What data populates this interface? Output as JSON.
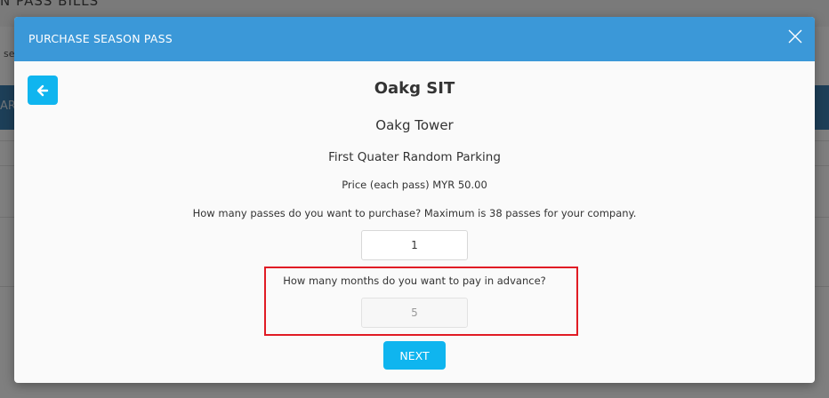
{
  "background": {
    "nav_text": "N PASS   BILLS",
    "search_text": "se",
    "band_text": "AR"
  },
  "modal": {
    "title": "PURCHASE SEASON PASS",
    "close_icon": "close-icon",
    "back_icon": "arrow-left-icon",
    "company_name": "Oakg SIT",
    "building": "Oakg Tower",
    "plan": "First Quater Random Parking",
    "price_text": "Price (each pass) MYR 50.00",
    "passes_question": "How many passes do you want to purchase? Maximum is 38 passes for your company.",
    "passes_value": "1",
    "months_question": "How many months do you want to pay in advance?",
    "months_value": "5",
    "next_label": "NEXT"
  },
  "colors": {
    "header": "#3b98d8",
    "button": "#0fb5ef",
    "highlight": "#e01b24"
  }
}
